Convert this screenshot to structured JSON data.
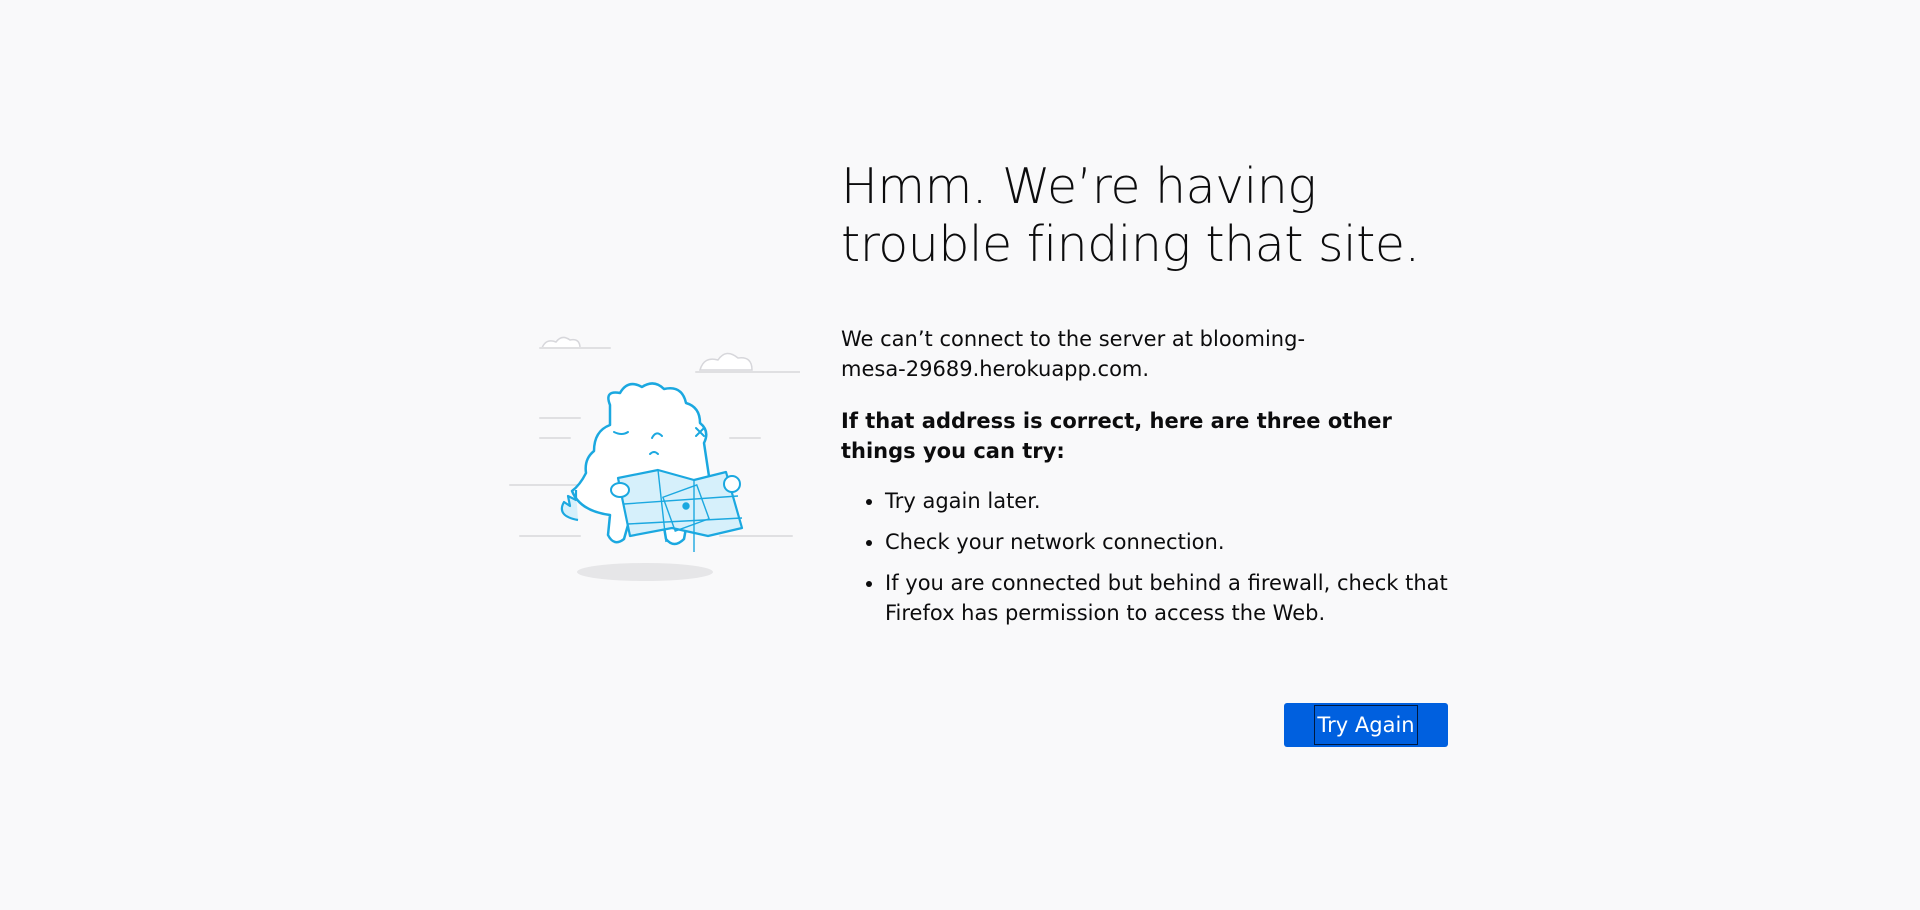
{
  "error": {
    "title": "Hmm. We’re having trouble finding that site.",
    "description": "We can’t connect to the server at blooming-mesa-29689.herokuapp.com.",
    "suggestions_heading": "If that address is correct, here are three other things you can try:",
    "suggestions": [
      "Try again later.",
      "Check your network connection.",
      "If you are connected but behind a firewall, check that Firefox has permission to access the Web."
    ],
    "try_again_label": "Try Again"
  },
  "colors": {
    "background": "#f9f9fa",
    "button": "#0060df",
    "illustration_stroke": "#1ba8e0",
    "illustration_fill": "#d6f0fb"
  },
  "icons": {
    "illustration": "lost-monster-with-map-illustration"
  }
}
